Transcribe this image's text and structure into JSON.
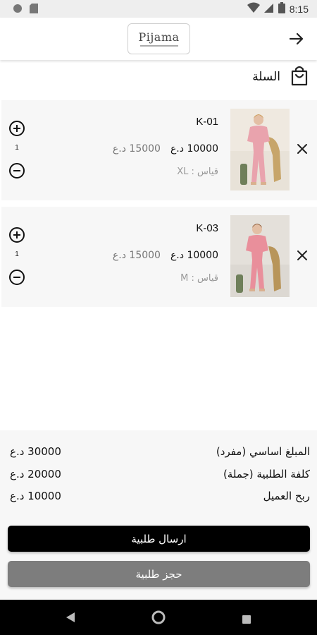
{
  "status_bar": {
    "time": "8:15",
    "icons": [
      "circle-icon",
      "sd-card-icon",
      "wifi-icon",
      "cell-signal-icon",
      "battery-icon"
    ]
  },
  "app_bar": {
    "logo_text": "Pijama",
    "back_icon": "arrow-right-icon"
  },
  "cart": {
    "title": "السلة",
    "title_icon": "shopping-bag-icon",
    "items": [
      {
        "code": "K-01",
        "price": "10000 د.ع",
        "old_price": "15000 د.ع",
        "size": "قياس : XL",
        "quantity": "1"
      },
      {
        "code": "K-03",
        "price": "10000 د.ع",
        "old_price": "15000 د.ع",
        "size": "قياس : M",
        "quantity": "1"
      }
    ]
  },
  "summary": {
    "base_amount_label": "المبلغ اساسي (مفرد)",
    "base_amount_value": "30000 د.ع",
    "order_cost_label": "كلفة الطلبية (جملة)",
    "order_cost_value": "20000 د.ع",
    "customer_profit_label": "ربح العميل",
    "customer_profit_value": "10000 د.ع"
  },
  "actions": {
    "send_order": "ارسال طلبية",
    "book_order": "حجز طلبية"
  },
  "colors": {
    "primary_button": "#000000",
    "secondary_button": "#7d7d7d",
    "card_background": "#f7f7f7",
    "pajama_pink": "#e9a3ad"
  }
}
